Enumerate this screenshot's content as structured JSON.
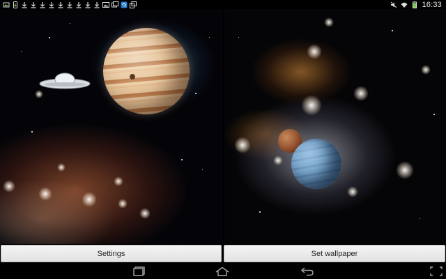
{
  "status_bar": {
    "left_icons": [
      "wallpaper-picker-icon",
      "phone-update-icon",
      "download-icon",
      "download-icon",
      "download-icon",
      "download-icon",
      "download-icon",
      "download-icon",
      "download-icon",
      "download-icon",
      "download-icon",
      "image-icon",
      "gallery-icon",
      "sync-icon",
      "copy-icon"
    ],
    "right_icons": [
      "mute-icon",
      "wifi-icon",
      "battery-icon"
    ],
    "time": "16:33",
    "battery_level": 0.9
  },
  "preview": {
    "left_scene": [
      "jupiter",
      "ufo",
      "nebula"
    ],
    "right_scene": [
      "star-cluster",
      "red-planet",
      "blue-planet"
    ]
  },
  "buttons": {
    "settings_label": "Settings",
    "set_wallpaper_label": "Set wallpaper"
  },
  "nav_bar": {
    "icons": [
      "recent-apps-icon",
      "home-icon",
      "back-icon",
      "screenshot-icon"
    ]
  },
  "colors": {
    "background": "#000000",
    "button_face": "#ececec",
    "button_text": "#222222",
    "status_icon": "#dddddd"
  }
}
